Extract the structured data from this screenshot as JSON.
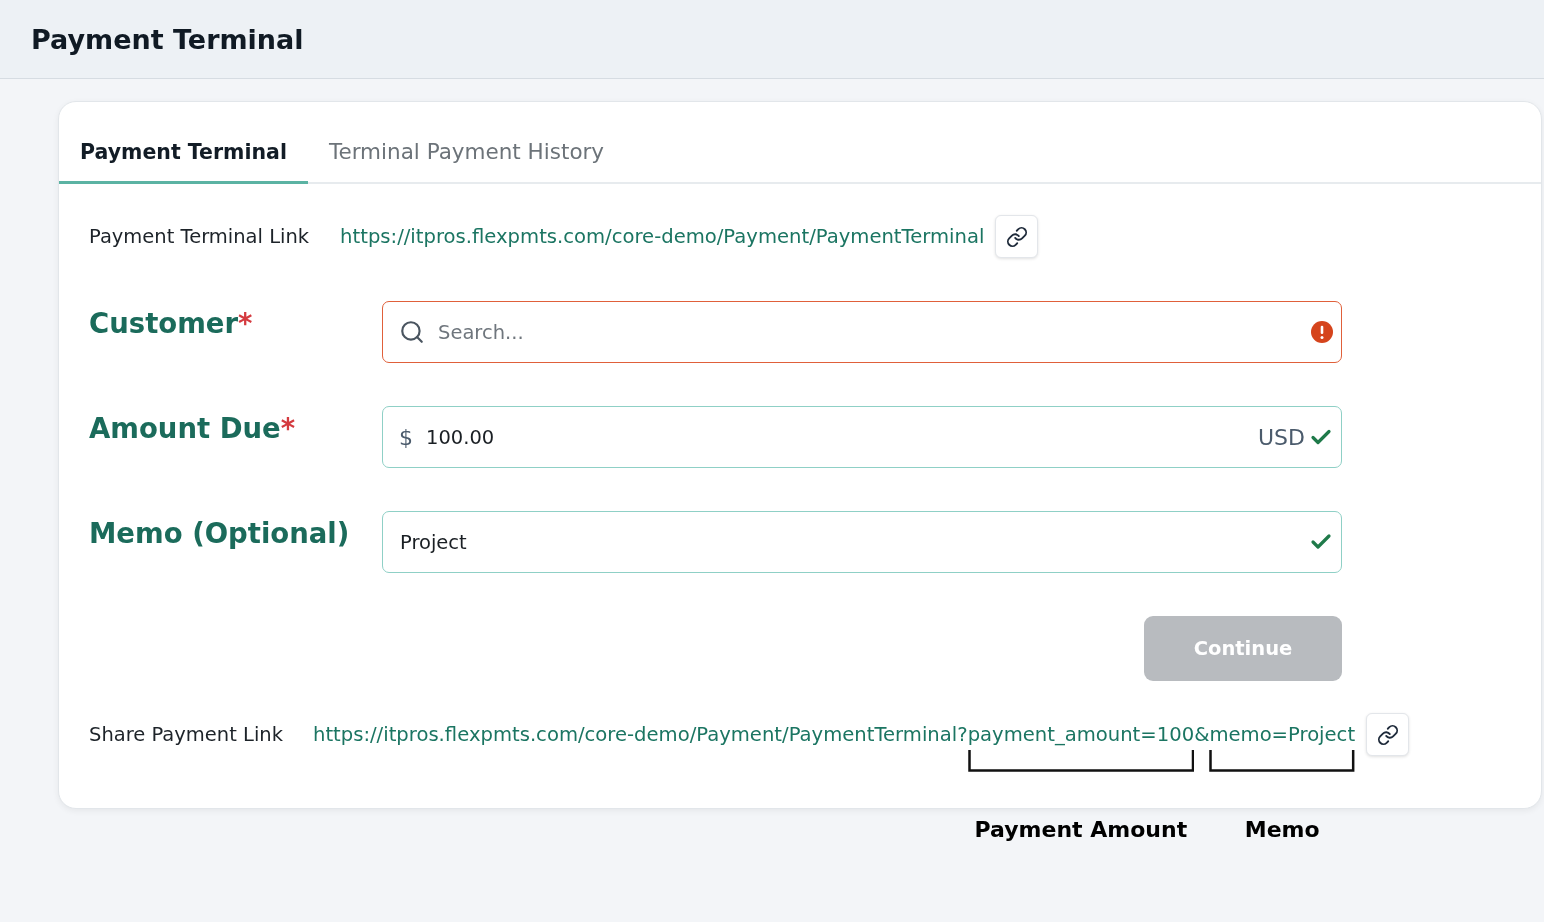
{
  "header": {
    "title": "Payment Terminal"
  },
  "tabs": [
    {
      "label": "Payment Terminal",
      "selected": true
    },
    {
      "label": "Terminal Payment History",
      "selected": false
    }
  ],
  "terminal_link": {
    "label": "Payment Terminal Link",
    "url": "https://itpros.flexpmts.com/core-demo/Payment/PaymentTerminal"
  },
  "fields": [
    {
      "kind": "search",
      "label": "Customer",
      "required_mark": "*",
      "placeholder": "Search...",
      "error": true,
      "valid": false
    },
    {
      "kind": "amount",
      "label": "Amount Due",
      "required_mark": "*",
      "prefix": "$",
      "value": "100.00",
      "suffix": "USD",
      "error": false,
      "valid": true
    },
    {
      "kind": "text",
      "label": "Memo (Optional)",
      "value": "Project",
      "error": false,
      "valid": true
    }
  ],
  "continue_button": {
    "label": "Continue",
    "disabled": true
  },
  "share_link": {
    "label": "Share Payment Link",
    "url_parts": [
      {
        "text": "https://itpros.flexpmts.com/core-demo/Payment/PaymentTerminal?"
      },
      {
        "text": "payment_amount=100",
        "annotation": "Payment Amount"
      },
      {
        "text": "&"
      },
      {
        "text": "memo=Project",
        "annotation": "Memo"
      }
    ]
  }
}
